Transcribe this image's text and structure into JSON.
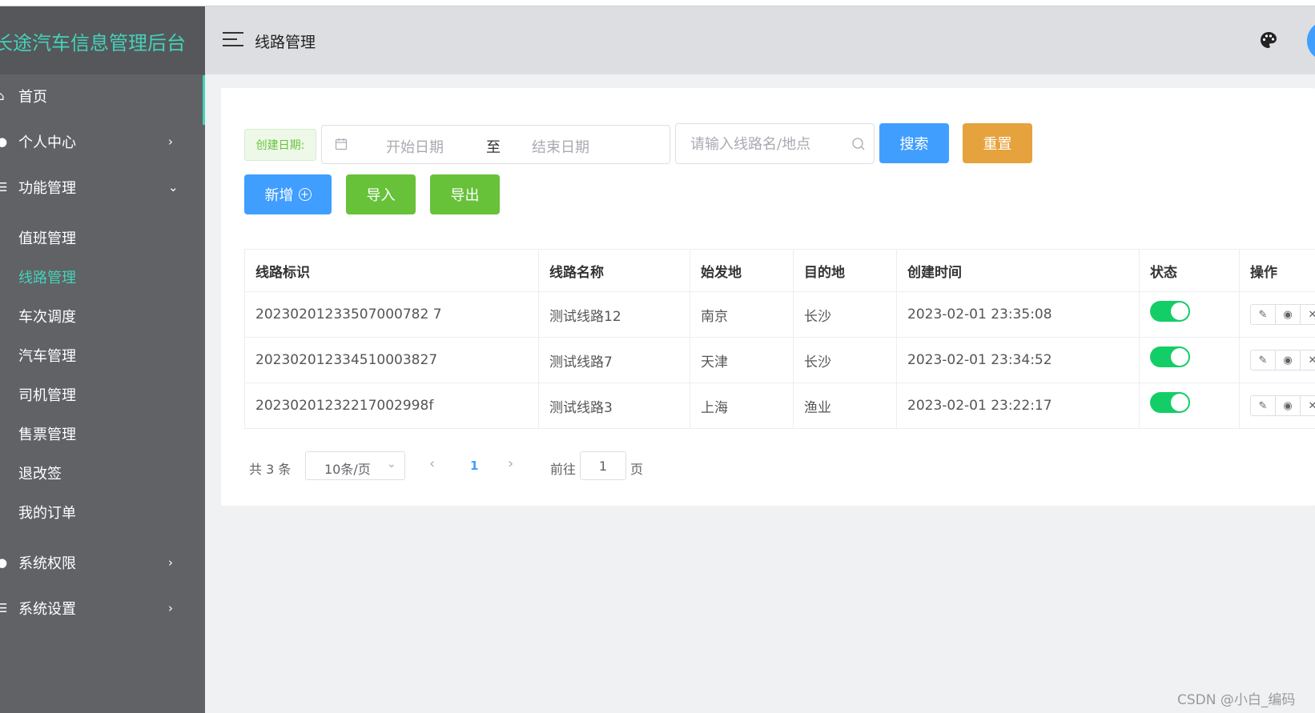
{
  "app": {
    "title": "长途汽车信息管理后台"
  },
  "sidebar": {
    "items": [
      {
        "label": "首页",
        "icon": "home-icon"
      },
      {
        "label": "个人中心",
        "icon": "user-icon",
        "arrow": "›"
      },
      {
        "label": "功能管理",
        "icon": "menu-icon",
        "arrow": "⌄"
      },
      {
        "label": "值班管理"
      },
      {
        "label": "线路管理",
        "active": true
      },
      {
        "label": "车次调度"
      },
      {
        "label": "汽车管理"
      },
      {
        "label": "司机管理"
      },
      {
        "label": "售票管理"
      },
      {
        "label": "退改签"
      },
      {
        "label": "我的订单"
      },
      {
        "label": "系统权限",
        "icon": "lock-icon",
        "arrow": "›"
      },
      {
        "label": "系统设置",
        "icon": "settings-icon",
        "arrow": "›"
      }
    ],
    "accent": "#45d1b8"
  },
  "header": {
    "page_title": "线路管理"
  },
  "filters": {
    "date_label": "创建日期:",
    "start_placeholder": "开始日期",
    "separator": "至",
    "end_placeholder": "结束日期",
    "search_placeholder": "请输入线路名/地点",
    "search_button": "搜索",
    "reset_button": "重置"
  },
  "actions": {
    "add": "新增",
    "import": "导入",
    "export": "导出"
  },
  "table": {
    "columns": [
      "线路标识",
      "线路名称",
      "始发地",
      "目的地",
      "创建时间",
      "状态",
      "操作"
    ],
    "rows": [
      {
        "id": "20230201233507000782 7",
        "name": "测试线路12",
        "from": "南京",
        "to": "长沙",
        "created": "2023-02-01 23:35:08",
        "status": "on"
      },
      {
        "id": "202302012334510003827",
        "name": "测试线路7",
        "from": "天津",
        "to": "长沙",
        "created": "2023-02-01 23:34:52",
        "status": "on"
      },
      {
        "id": "20230201232217002998f",
        "name": "测试线路3",
        "from": "上海",
        "to": "渔业",
        "created": "2023-02-01 23:22:17",
        "status": "on"
      }
    ]
  },
  "pagination": {
    "total": "共 3 条",
    "page_size": "10条/页",
    "current": "1",
    "goto_prefix": "前往",
    "goto_value": "1",
    "goto_suffix": "页"
  },
  "watermark": "CSDN @小白_编码",
  "colors": {
    "primary": "#409eff",
    "success": "#67c23a",
    "warning": "#e6a23c",
    "switch_on": "#13ce66"
  }
}
